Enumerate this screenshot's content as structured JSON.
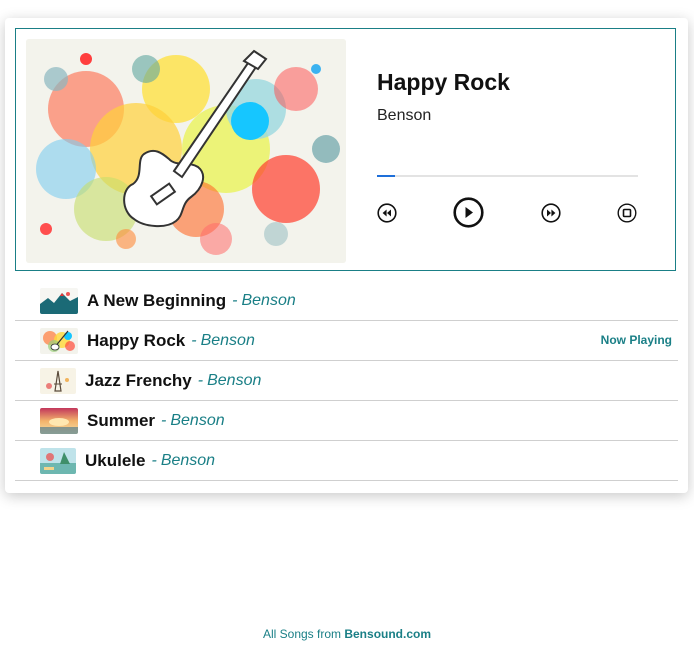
{
  "player": {
    "title": "Happy Rock",
    "artist": "Benson",
    "progress_percent": 7,
    "controls": {
      "rewind": "rewind-icon",
      "play": "play-icon",
      "forward": "fast-forward-icon",
      "stop": "stop-icon"
    },
    "accent_color": "#1a7f86",
    "progress_color": "#1e6fd9"
  },
  "playlist": [
    {
      "title": "A New Beginning",
      "separator": "-",
      "artist": "Benson",
      "status": "",
      "thumb": "mountain-thumb"
    },
    {
      "title": "Happy Rock",
      "separator": "-",
      "artist": "Benson",
      "status": "Now Playing",
      "thumb": "guitar-thumb"
    },
    {
      "title": "Jazz Frenchy",
      "separator": "-",
      "artist": "Benson",
      "status": "",
      "thumb": "eiffel-thumb"
    },
    {
      "title": "Summer",
      "separator": "-",
      "artist": "Benson",
      "status": "",
      "thumb": "sunset-thumb"
    },
    {
      "title": "Ukulele",
      "separator": "-",
      "artist": "Benson",
      "status": "",
      "thumb": "beach-thumb"
    }
  ],
  "footer": {
    "prefix": "All Songs from",
    "link": "Bensound.com"
  }
}
